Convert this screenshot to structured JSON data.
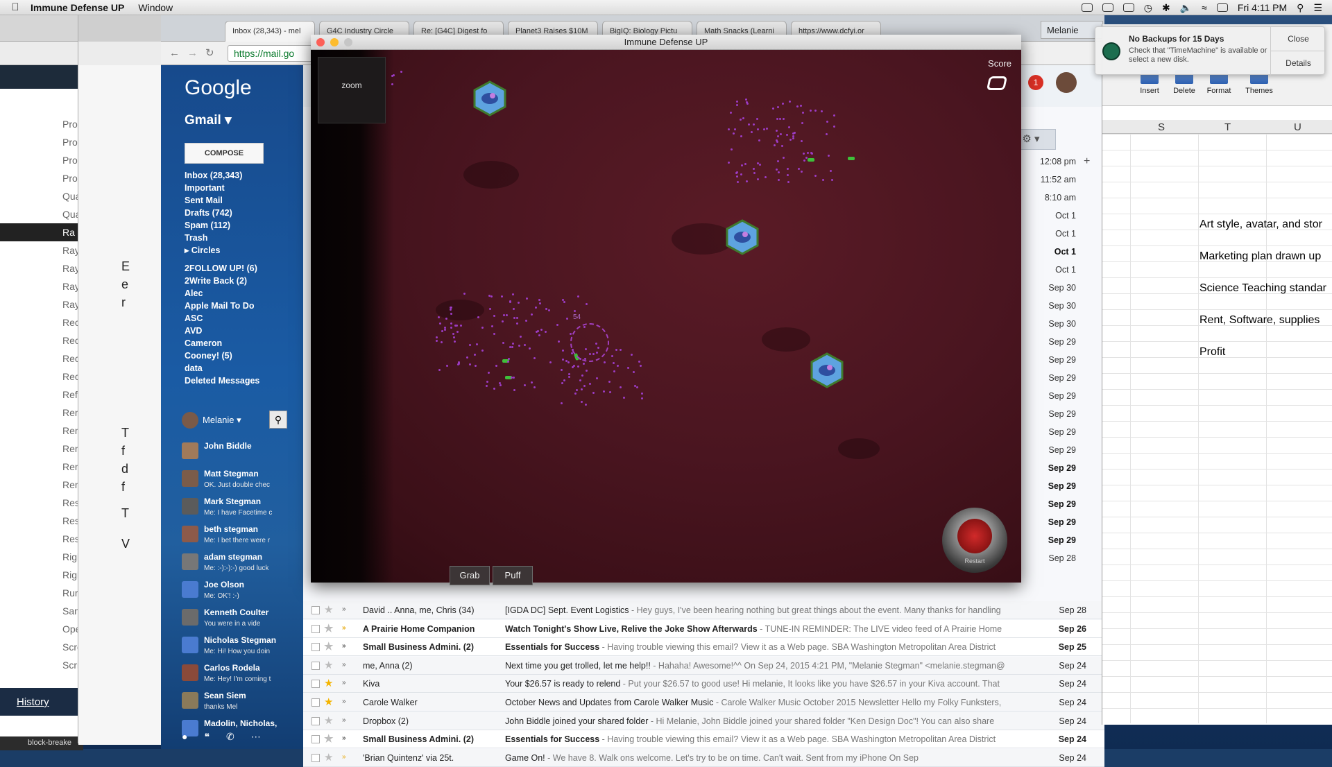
{
  "menubar": {
    "app_name": "Immune Defense UP",
    "menu_window": "Window",
    "clock": "Fri 4:11 PM"
  },
  "left_browser": {
    "items": [
      "Pro",
      "Pro",
      "Pro",
      "Pro",
      "Qua",
      "Qua",
      "Ra",
      "Ray",
      "Ray",
      "Ray",
      "Ray",
      "Rec",
      "Rec",
      "Rec",
      "Rec",
      "Refl",
      "Ren",
      "Ren",
      "Ren",
      "Ren",
      "Ren",
      "Res",
      "Res",
      "Res",
      "Rigl",
      "Rigl",
      "Rur",
      "San",
      "Ope",
      "Scre",
      "Scri"
    ],
    "selected_index": 6,
    "history_label": "History",
    "download_label": "block-breake"
  },
  "gmail": {
    "tabs": [
      {
        "label": "Inbox (28,343) - mel"
      },
      {
        "label": "G4C Industry Circle"
      },
      {
        "label": "Re: [G4C] Digest fo"
      },
      {
        "label": "Planet3 Raises $10M"
      },
      {
        "label": "BigIQ: Biology Pictu"
      },
      {
        "label": "Math Snacks (Learni"
      },
      {
        "label": "https://www.dcfyi.or"
      }
    ],
    "url": "https://mail.go",
    "user_chip": "Melanie",
    "logo": "Google",
    "product": "Gmail ▾",
    "compose": "COMPOSE",
    "labels": [
      "Inbox (28,343)",
      "Important",
      "Sent Mail",
      "Drafts (742)",
      "Spam (112)",
      "Trash",
      "▸ Circles",
      "",
      "2FOLLOW UP! (6)",
      "2Write Back (2)",
      "Alec",
      "Apple Mail To Do",
      "ASC",
      "AVD",
      "Cameron",
      "Cooney! (5)",
      "data",
      "Deleted Messages"
    ],
    "chat_user": "Melanie ▾",
    "contacts": [
      {
        "name": "John Biddle",
        "status": ""
      },
      {
        "name": "Matt Stegman",
        "status": "OK.   Just double chec"
      },
      {
        "name": "Mark Stegman",
        "status": "Me: I have Facetime c"
      },
      {
        "name": "beth stegman",
        "status": "Me: I bet there were r"
      },
      {
        "name": "adam stegman",
        "status": "Me: :-):-):-)  good luck"
      },
      {
        "name": "Joe Olson",
        "status": "Me: OK'! :-)"
      },
      {
        "name": "Kenneth Coulter",
        "status": "You were in a vide"
      },
      {
        "name": "Nicholas Stegman",
        "status": "Me: Hi!  How you doin"
      },
      {
        "name": "Carlos Rodela",
        "status": "Me: Hey!  I'm coming t"
      },
      {
        "name": "Sean Siem",
        "status": "thanks Mel"
      },
      {
        "name": "Madolin, Nicholas,",
        "status": ""
      }
    ],
    "dates_top": [
      {
        "d": "12:08 pm",
        "b": false
      },
      {
        "d": "11:52 am",
        "b": false
      },
      {
        "d": "8:10 am",
        "b": false
      },
      {
        "d": "Oct 1",
        "b": false
      },
      {
        "d": "Oct 1",
        "b": false
      },
      {
        "d": "Oct 1",
        "b": true
      },
      {
        "d": "Oct 1",
        "b": false
      },
      {
        "d": "Sep 30",
        "b": false
      },
      {
        "d": "Sep 30",
        "b": false
      },
      {
        "d": "Sep 30",
        "b": false
      },
      {
        "d": "Sep 29",
        "b": false
      },
      {
        "d": "Sep 29",
        "b": false
      },
      {
        "d": "Sep 29",
        "b": false
      },
      {
        "d": "Sep 29",
        "b": false
      },
      {
        "d": "Sep 29",
        "b": false
      },
      {
        "d": "Sep 29",
        "b": false
      },
      {
        "d": "Sep 29",
        "b": false
      },
      {
        "d": "Sep 29",
        "b": true
      },
      {
        "d": "Sep 29",
        "b": true
      },
      {
        "d": "Sep 29",
        "b": true
      },
      {
        "d": "Sep 29",
        "b": true
      },
      {
        "d": "Sep 29",
        "b": true
      },
      {
        "d": "Sep 28",
        "b": false
      }
    ],
    "rows": [
      {
        "from": "David .. Anna, me, Chris (34)",
        "subject": "[IGDA DC] Sept. Event Logistics",
        "snippet": " - Hey guys, I've been hearing nothing but great things about the event. Many thanks for handling",
        "date": "Sep 28",
        "unread": false,
        "star": false,
        "imp": false
      },
      {
        "from": "A Prairie Home Companion",
        "subject": "Watch Tonight's Show Live, Relive the Joke Show Afterwards",
        "snippet": " - TUNE-IN REMINDER: The LIVE video feed of A Prairie Home",
        "date": "Sep 26",
        "unread": true,
        "star": false,
        "imp": true
      },
      {
        "from": "Small Business Admini. (2)",
        "subject": "Essentials for Success",
        "snippet": " - Having trouble viewing this email? View it as a Web page. SBA Washington Metropolitan Area District",
        "date": "Sep 25",
        "unread": true,
        "star": false,
        "imp": false
      },
      {
        "from": "me, Anna (2)",
        "subject": "Next time you get trolled, let me help!!",
        "snippet": " - Hahaha! Awesome!^^ On Sep 24, 2015 4:21 PM, \"Melanie Stegman\" <melanie.stegman@",
        "date": "Sep 24",
        "unread": false,
        "star": false,
        "imp": false
      },
      {
        "from": "Kiva",
        "subject": "Your $26.57 is ready to relend",
        "snippet": " - Put your $26.57 to good use! Hi melanie, It looks like you have $26.57 in your Kiva account. That",
        "date": "Sep 24",
        "unread": false,
        "star": true,
        "imp": false
      },
      {
        "from": "Carole Walker",
        "subject": "October News and Updates from Carole Walker Music",
        "snippet": " - Carole Walker Music October 2015 Newsletter Hello my Folky Funksters,",
        "date": "Sep 24",
        "unread": false,
        "star": true,
        "imp": false
      },
      {
        "from": "Dropbox (2)",
        "subject": "John Biddle joined your shared folder",
        "snippet": " - Hi Melanie, John Biddle joined your shared folder \"Ken Design Doc\"! You can also share",
        "date": "Sep 24",
        "unread": false,
        "star": false,
        "imp": false
      },
      {
        "from": "Small Business Admini. (2)",
        "subject": "Essentials for Success",
        "snippet": " - Having trouble viewing this email? View it as a Web page. SBA Washington Metropolitan Area District",
        "date": "Sep 24",
        "unread": true,
        "star": false,
        "imp": false
      },
      {
        "from": "'Brian Quintenz' via 25t.",
        "subject": "Game On!",
        "snippet": " - We have 8. Walk ons welcome. Let's try to be on time. Can't wait. Sent from my iPhone On Sep",
        "date": "Sep 24",
        "unread": false,
        "star": false,
        "imp": true
      }
    ]
  },
  "excel": {
    "ribbon": [
      "Insert",
      "Delete",
      "Format",
      "Themes"
    ],
    "columns": [
      "S",
      "T",
      "U"
    ],
    "cells": [
      "Art style, avatar, and stor",
      "Marketing plan drawn up",
      "Science Teaching standar",
      "Rent, Software, supplies",
      "Profit"
    ]
  },
  "notification": {
    "title": "No Backups for 15 Days",
    "body": "Check that \"TimeMachine\" is available or select a new disk.",
    "close": "Close",
    "details": "Details"
  },
  "game": {
    "window_title": "Immune Defense UP",
    "zoom": "zoom",
    "score_label": "Score",
    "grab": "Grab",
    "puff": "Puff",
    "restart": "Restart",
    "ring_number": "54"
  },
  "left_snips": [
    "E",
    "e",
    "r",
    "T",
    "f",
    "d",
    "f",
    "T",
    "V"
  ]
}
